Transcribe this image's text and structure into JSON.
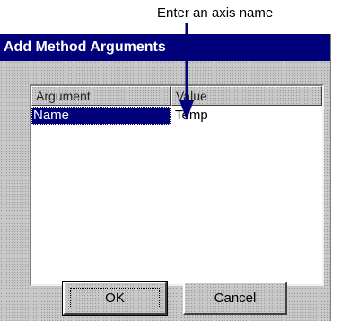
{
  "annotation": {
    "text": "Enter an axis name"
  },
  "dialog": {
    "title": "Add Method Arguments"
  },
  "list": {
    "columns": [
      "Argument",
      "Value"
    ],
    "rows": [
      {
        "argument": "Name",
        "value": "Temp",
        "selected": true
      }
    ]
  },
  "buttons": {
    "ok_label": "OK",
    "cancel_label": "Cancel"
  },
  "colors": {
    "title_bar": "#00007b",
    "selection": "#00007b",
    "dialog_face": "#c8c8c8",
    "arrow": "#00007b"
  }
}
